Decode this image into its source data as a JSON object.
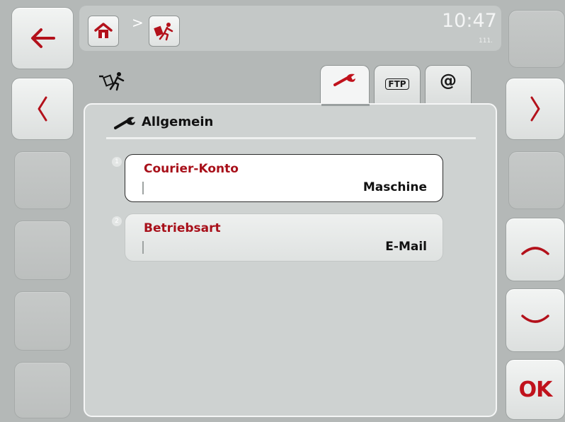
{
  "header": {
    "breadcrumb_separator": ">",
    "clock": "10:47",
    "clock_sub": "111."
  },
  "tabs": [
    {
      "name": "general",
      "icon": "wrench-icon"
    },
    {
      "name": "ftp",
      "label": "FTP"
    },
    {
      "name": "email",
      "label": "@"
    }
  ],
  "section": {
    "title": "Allgemein",
    "icon": "wrench-icon"
  },
  "fields": [
    {
      "number": "1",
      "label": "Courier-Konto",
      "value": "Maschine",
      "selected": true
    },
    {
      "number": "2",
      "label": "Betriebsart",
      "value": "E-Mail",
      "selected": false
    }
  ],
  "softkeys": {
    "ok_label": "OK"
  },
  "colors": {
    "accent_red": "#b3111b",
    "background": "#b4b8b7",
    "panel": "#ced2d1"
  }
}
